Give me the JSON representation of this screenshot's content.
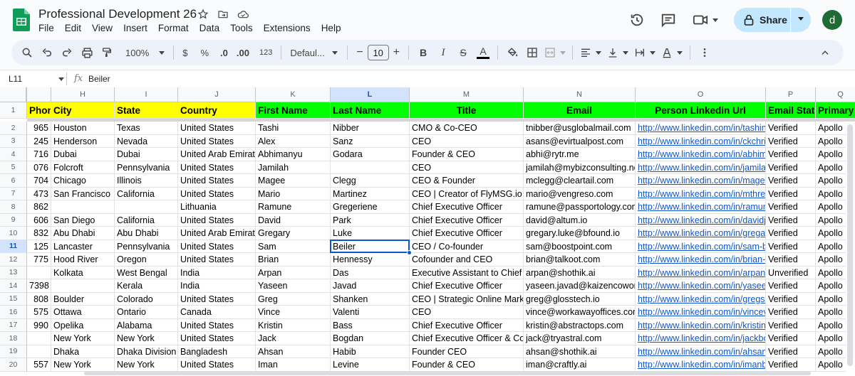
{
  "app": {
    "title": "Professional Development 26",
    "menu": [
      "File",
      "Edit",
      "View",
      "Insert",
      "Format",
      "Data",
      "Tools",
      "Extensions",
      "Help"
    ],
    "share_label": "Share",
    "avatar_letter": "d"
  },
  "toolbar": {
    "zoom": "100%",
    "currency": "$",
    "percent": "%",
    "decimal_decrease": ".0",
    "decimal_increase": ".00",
    "number_format": "123",
    "font": "Defaul...",
    "font_size": "10",
    "minus": "−",
    "plus": "+",
    "bold": "B",
    "italic": "I",
    "strike": "S",
    "text_color": "A"
  },
  "formula": {
    "name_box": "L11",
    "fx": "fx",
    "value": "Beiler"
  },
  "grid": {
    "columns": [
      "",
      "H",
      "I",
      "J",
      "K",
      "L",
      "M",
      "N",
      "O",
      "P",
      "Q"
    ],
    "header_row_number": "1",
    "headers": [
      "Phone",
      "City",
      "State",
      "Country",
      "First Name",
      "Last Name",
      "Title",
      "Email",
      "Person Linkedin Url",
      "Email Status",
      "Primary"
    ],
    "rows": [
      {
        "n": "2",
        "c": [
          "965",
          "Houston",
          "Texas",
          "United States",
          "Tashi",
          "Nibber",
          "CMO & Co-CEO",
          "tnibber@usglobalmail.com",
          "http://www.linkedin.com/in/tashinibb",
          "Verified",
          "Apollo"
        ]
      },
      {
        "n": "3",
        "c": [
          "245",
          "Henderson",
          "Nevada",
          "United States",
          "Alex",
          "Sanz",
          "CEO",
          "asans@evirtualpost.com",
          "http://www.linkedin.com/in/ckchris",
          "Verified",
          "Apollo"
        ]
      },
      {
        "n": "4",
        "c": [
          "716",
          "Dubai",
          "Dubai",
          "United Arab Emirates",
          "Abhimanyu",
          "Godara",
          "Founder & CEO",
          "abhi@rytr.me",
          "http://www.linkedin.com/in/abhiman",
          "Verified",
          "Apollo"
        ]
      },
      {
        "n": "5",
        "c": [
          "076",
          "Folcroft",
          "Pennsylvania",
          "United States",
          "Jamilah",
          "",
          "CEO",
          "jamilah@mybizconsulting.net",
          "http://www.linkedin.com/in/jamilahl",
          "Verified",
          "Apollo"
        ]
      },
      {
        "n": "6",
        "c": [
          "704",
          "Chicago",
          "Illinois",
          "United States",
          "Magee",
          "Clegg",
          "CEO & Founder",
          "mclegg@cleartail.com",
          "http://www.linkedin.com/in/mageec",
          "Verified",
          "Apollo"
        ]
      },
      {
        "n": "7",
        "c": [
          "473",
          "San Francisco",
          "California",
          "United States",
          "Mario",
          "Martinez",
          "CEO | Creator of FlyMSG.io the",
          "mario@vengreso.com",
          "http://www.linkedin.com/in/mthreeji",
          "Verified",
          "Apollo"
        ]
      },
      {
        "n": "8",
        "c": [
          "862",
          "",
          "",
          "Lithuania",
          "Ramune",
          "Gregeriene",
          "Chief Executive Officer",
          "ramune@passportology.com",
          "http://www.linkedin.com/in/ramune-",
          "Verified",
          "Apollo"
        ]
      },
      {
        "n": "9",
        "c": [
          "606",
          "San Diego",
          "California",
          "United States",
          "David",
          "Park",
          "Chief Executive Officer",
          "david@altum.io",
          "http://www.linkedin.com/in/davidjpa",
          "Verified",
          "Apollo"
        ]
      },
      {
        "n": "10",
        "c": [
          "832",
          "Abu Dhabi",
          "Abu Dhabi",
          "United Arab Emirates",
          "Gregary",
          "Luke",
          "Chief Executive Officer",
          "gregary.luke@bfound.io",
          "http://www.linkedin.com/in/gregary-",
          "Verified",
          "Apollo"
        ]
      },
      {
        "n": "11",
        "c": [
          "125",
          "Lancaster",
          "Pennsylvania",
          "United States",
          "Sam",
          "Beiler",
          "CEO / Co-founder",
          "sam@boostpoint.com",
          "http://www.linkedin.com/in/sam-bei",
          "Verified",
          "Apollo"
        ]
      },
      {
        "n": "12",
        "c": [
          "775",
          "Hood River",
          "Oregon",
          "United States",
          "Brian",
          "Hennessy",
          "Cofounder and CEO",
          "brian@talkoot.com",
          "http://www.linkedin.com/in/brian-he",
          "Verified",
          "Apollo"
        ]
      },
      {
        "n": "13",
        "c": [
          "",
          "Kolkata",
          "West Bengal",
          "India",
          "Arpan",
          "Das",
          "Executive Assistant to Chief E",
          "arpan@shothik.ai",
          "http://www.linkedin.com/in/arpan-d",
          "Unverified",
          "Apollo"
        ]
      },
      {
        "n": "14",
        "c": [
          "7398",
          "",
          "Kerala",
          "India",
          "Yaseen",
          "Javad",
          "Chief Executive Officer",
          "yaseen.javad@kaizencoworks",
          "http://www.linkedin.com/in/yaseen-",
          "Verified",
          "Apollo"
        ]
      },
      {
        "n": "15",
        "c": [
          "808",
          "Boulder",
          "Colorado",
          "United States",
          "Greg",
          "Shanken",
          "CEO | Strategic Online Market",
          "greg@glosstech.io",
          "http://www.linkedin.com/in/gregsha",
          "Verified",
          "Apollo"
        ]
      },
      {
        "n": "16",
        "c": [
          "575",
          "Ottawa",
          "Ontario",
          "Canada",
          "Vince",
          "Valenti",
          "CEO",
          "vince@workawayoffices.com",
          "http://www.linkedin.com/in/vinceval",
          "Verified",
          "Apollo"
        ]
      },
      {
        "n": "17",
        "c": [
          "990",
          "Opelika",
          "Alabama",
          "United States",
          "Kristin",
          "Bass",
          "Chief Executive Officer",
          "kristin@abstractops.com",
          "http://www.linkedin.com/in/kristin-b",
          "Verified",
          "Apollo"
        ]
      },
      {
        "n": "18",
        "c": [
          "",
          "New York",
          "New York",
          "United States",
          "Jack",
          "Bogdan",
          "Chief Executive Officer & Co-F",
          "jack@tryastral.com",
          "http://www.linkedin.com/in/jackbog",
          "Verified",
          "Apollo"
        ]
      },
      {
        "n": "19",
        "c": [
          "",
          "Dhaka",
          "Dhaka Division",
          "Bangladesh",
          "Ahsan",
          "Habib",
          "Founder CEO",
          "ahsan@shothik.ai",
          "http://www.linkedin.com/in/ahsan57",
          "Verified",
          "Apollo"
        ]
      },
      {
        "n": "20",
        "c": [
          "557",
          "New York",
          "New York",
          "United States",
          "Iman",
          "Levine",
          "Founder & CEO",
          "iman@craftly.ai",
          "http://www.linkedin.com/in/imanbas",
          "Verified",
          "Apollo"
        ]
      }
    ]
  },
  "colors": {
    "header_yellow": "#ffff00",
    "header_green": "#00ff00",
    "accent": "#0b57d0",
    "share_bg": "#c2e7ff"
  },
  "icons": [
    "sheets-logo",
    "star-icon",
    "move-icon",
    "cloud-icon",
    "history-icon",
    "comment-icon",
    "meet-icon",
    "lock-icon",
    "search-icon",
    "undo-icon",
    "redo-icon",
    "print-icon",
    "paint-format-icon",
    "fill-color-icon",
    "borders-icon",
    "merge-icon",
    "align-icon",
    "valign-icon",
    "wrap-icon",
    "rotate-icon",
    "more-icon",
    "collapse-icon"
  ]
}
